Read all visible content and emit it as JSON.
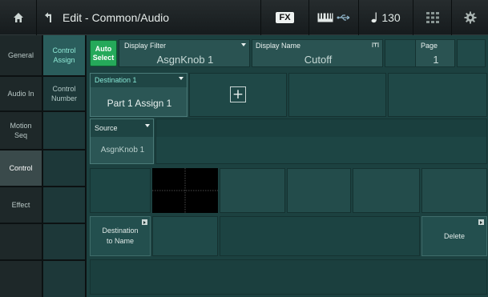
{
  "header": {
    "title": "Edit - Common/Audio",
    "fx_badge": "FX",
    "tempo": "130",
    "icons": [
      "home-icon",
      "back-arrow-icon",
      "keyboard-icon",
      "usb-icon",
      "note-icon",
      "grid-icon",
      "gear-icon"
    ]
  },
  "sidebar": {
    "items": [
      {
        "label": "General"
      },
      {
        "label": "Audio In"
      },
      {
        "label": "Motion Seq"
      },
      {
        "label": "Control"
      },
      {
        "label": "Effect"
      }
    ]
  },
  "subnav": {
    "items": [
      {
        "label": "Control Assign"
      },
      {
        "label": "Control Number"
      }
    ]
  },
  "main": {
    "auto_select": {
      "line1": "Auto",
      "line2": "Select"
    },
    "display_filter": {
      "label": "Display Filter",
      "value": "AsgnKnob 1"
    },
    "display_name": {
      "label": "Display Name",
      "value": "Cutoff"
    },
    "page": {
      "label": "Page",
      "value": "1"
    },
    "destination": {
      "label": "Destination 1",
      "value": "Part 1 Assign 1"
    },
    "add_symbol": "+",
    "source": {
      "label": "Source",
      "value": "AsgnKnob 1"
    },
    "dest_to_name": {
      "line1": "Destination",
      "line2": "to Name"
    },
    "delete_label": "Delete"
  },
  "colors": {
    "accent_green": "#25a95a",
    "panel_teal": "#1c4140",
    "active_tab": "#2a5d5c",
    "active_text": "#8fe9d6"
  }
}
